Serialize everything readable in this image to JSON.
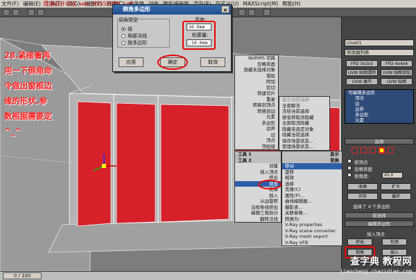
{
  "watermark_top": "思缘设计论坛 www.MISSYUAN.com",
  "menubar": [
    "文件(F)",
    "编辑(E)",
    "工具(T)",
    "组(G)",
    "视图(V)",
    "创建(C)",
    "修改器",
    "动画",
    "图形编辑器",
    "渲染(R)",
    "自定义(U)",
    "MAXScript(M)",
    "帮助(H)"
  ],
  "tutorial_text": "28.紧接着再\n用一下倒角命\n令做出窗框边\n缘的形状.参\n数根据需要定\n^_^",
  "dialog": {
    "title": "倒角多边形",
    "group_label": "倒角类型",
    "radio_group": "组",
    "radio_local": "局部法线",
    "radio_poly": "按多边形",
    "height_label": "高度:",
    "height_value": "10.0mm",
    "outline_label": "轮廓量:",
    "outline_value": "-10.0mm",
    "apply": "应用",
    "ok": "确定",
    "cancel": "取消"
  },
  "quad_menu_top": [
    "NURMS 切换",
    "忽略背面",
    "隐藏未选择对象",
    "塌陷",
    "附加",
    "剪切",
    "快速切片",
    "重复",
    "转换到顶点",
    "转换到边",
    "元素",
    "多边形",
    "边界",
    "边",
    "顶点",
    "顶层级"
  ],
  "quad_menu_right": [
    "全部解冻",
    "冻结当前选择",
    "按名称取消隐藏",
    "全部取消隐藏",
    "隐藏未选定对象",
    "隐藏当前选择",
    "保存场景状态...",
    "管理场景状态..."
  ],
  "quad_menu_disabled": "孤立当前选择",
  "tools1_header": "工具 1",
  "tools2_header": "工具 2",
  "tools2_items": [
    "创建",
    "插入顶点",
    "挤出",
    "倒角",
    "轮廓",
    "插入",
    "从边旋转",
    "沿样条线挤出",
    "编辑三角剖分",
    "翻转法线"
  ],
  "display_header": "显示",
  "transform_header": "变换",
  "transform_items": [
    "移动",
    "旋转",
    "缩放",
    "选择",
    "克隆(C)",
    "属性(P)...",
    "曲线编辑器...",
    "摄影表...",
    "关联参数...",
    "转换为:",
    "V-Ray properties",
    "V-Ray scene converter",
    "V-Ray mesh export",
    "V-Ray VFB"
  ],
  "panel": {
    "object_name": "Line01",
    "modifier_list": "修改器列表",
    "ffd1": "FFD 3x3x3",
    "ffd2": "FFD 4x4x4",
    "uvw1": "UVW 贴图清除",
    "uvw2": "UVW 贴图添加",
    "uvw3": "UVW 展开",
    "uvw4": "UVW 贴图",
    "stack_root": "可编辑多边形",
    "stack_items": [
      "顶点",
      "边",
      "边界",
      "多边形",
      "元素"
    ],
    "selection_title": "选择",
    "by_vertex": "按顶点",
    "ignore_backface": "忽略背面",
    "by_angle": "按角度:",
    "angle_value": "45.0",
    "shrink": "收缩",
    "grow": "扩大",
    "ring": "环形",
    "loop": "循环",
    "selected_info": "选择了 4 个多边形",
    "soft_selection": "软选择",
    "edit_polygons": "编辑多边形",
    "insert_vertex": "插入顶点",
    "extrude": "挤出",
    "outline": "轮廓",
    "bevel": "倒角",
    "inset": "插入"
  },
  "status_frame": "0 / 100",
  "brand_cn": "查字典 教程网",
  "brand_url": "jiaocheng.chazidian.com",
  "colors": {
    "window_red": "#d6202a",
    "highlight": "#2b5ea8",
    "annotation": "#ff2222"
  }
}
